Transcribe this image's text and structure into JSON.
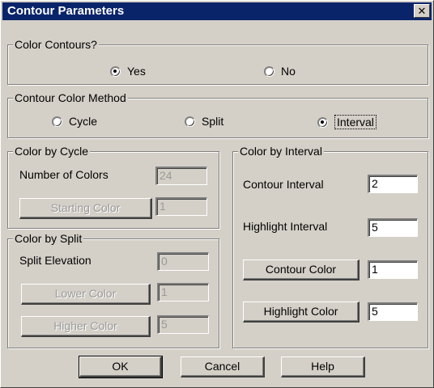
{
  "window": {
    "title": "Contour Parameters",
    "close_glyph": "✕"
  },
  "color_contours": {
    "legend": "Color Contours?",
    "options": [
      {
        "label": "Yes",
        "checked": true
      },
      {
        "label": "No",
        "checked": false
      }
    ]
  },
  "color_method": {
    "legend": "Contour Color Method",
    "options": [
      {
        "label": "Cycle",
        "checked": false
      },
      {
        "label": "Split",
        "checked": false
      },
      {
        "label": "Interval",
        "checked": true
      }
    ]
  },
  "by_cycle": {
    "legend": "Color by Cycle",
    "num_colors_label": "Number of Colors",
    "num_colors_value": "24",
    "starting_color_button": "Starting Color",
    "starting_color_value": "1"
  },
  "by_split": {
    "legend": "Color by Split",
    "elevation_label": "Split Elevation",
    "elevation_value": "0",
    "lower_color_button": "Lower Color",
    "lower_color_value": "1",
    "higher_color_button": "Higher Color",
    "higher_color_value": "5"
  },
  "by_interval": {
    "legend": "Color by Interval",
    "contour_interval_label": "Contour Interval",
    "contour_interval_value": "2",
    "highlight_interval_label": "Highlight Interval",
    "highlight_interval_value": "5",
    "contour_color_button": "Contour Color",
    "contour_color_value": "1",
    "highlight_color_button": "Highlight Color",
    "highlight_color_value": "5"
  },
  "footer": {
    "ok_label": "OK",
    "cancel_label": "Cancel",
    "help_label": "Help"
  }
}
